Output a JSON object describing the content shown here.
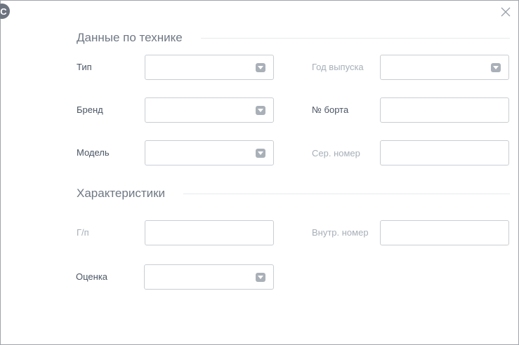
{
  "window": {
    "logo_letter": "C"
  },
  "section_equipment": {
    "title": "Данные по технике",
    "fields": {
      "type": {
        "label": "Тип",
        "value": ""
      },
      "year": {
        "label": "Год выпуска",
        "value": ""
      },
      "brand": {
        "label": "Бренд",
        "value": ""
      },
      "board_no": {
        "label": "№ борта",
        "value": ""
      },
      "model": {
        "label": "Модель",
        "value": ""
      },
      "serial_no": {
        "label": "Сер. номер",
        "value": ""
      }
    }
  },
  "section_specs": {
    "title": "Характеристики",
    "fields": {
      "capacity": {
        "label": "Г/п",
        "value": ""
      },
      "internal_no": {
        "label": "Внутр. номер",
        "value": ""
      },
      "rating": {
        "label": "Оценка",
        "value": ""
      }
    }
  },
  "icons": {
    "close": "close-icon",
    "dropdown": "chevron-down-icon"
  },
  "colors": {
    "border": "#c9cdd2",
    "label": "#4a5564",
    "label_muted": "#a7afb8",
    "section_title": "#6f7884",
    "caret_bg": "#a9b0b8"
  }
}
